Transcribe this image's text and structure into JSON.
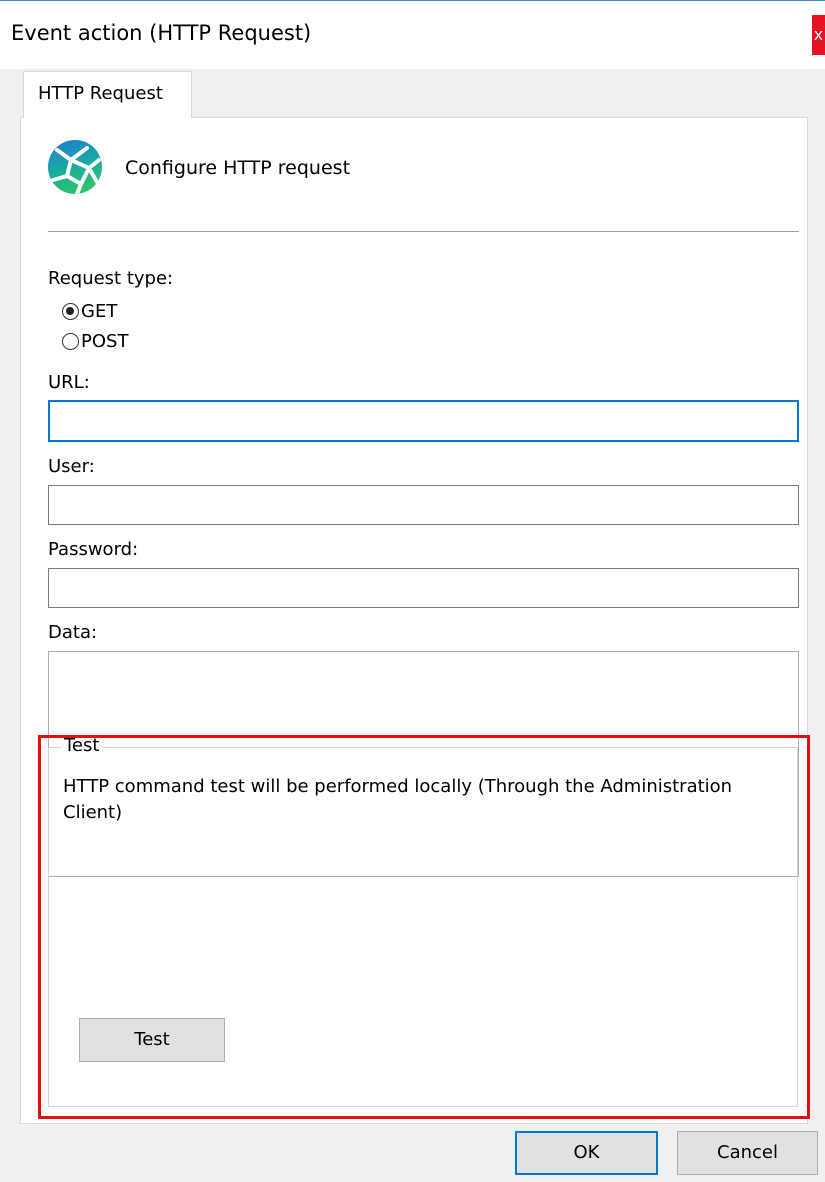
{
  "window": {
    "title": "Event action (HTTP Request)",
    "close_glyph": "x"
  },
  "tab": {
    "label": "HTTP Request"
  },
  "header": {
    "icon": "network-globe-icon",
    "label": "Configure HTTP request"
  },
  "request_type": {
    "label": "Request type:",
    "options": [
      {
        "label": "GET",
        "checked": true
      },
      {
        "label": "POST",
        "checked": false
      }
    ]
  },
  "fields": {
    "url_label": "URL:",
    "url_value": "",
    "user_label": "User:",
    "user_value": "",
    "password_label": "Password:",
    "password_value": "",
    "data_label": "Data:",
    "data_value": ""
  },
  "test_group": {
    "title": "Test",
    "description": "HTTP command test will be performed locally (Through the Administration Client)",
    "button_label": "Test"
  },
  "footer": {
    "ok_label": "OK",
    "cancel_label": "Cancel"
  },
  "colors": {
    "focus_border": "#0078d7",
    "highlight_border": "#e01010",
    "close_button": "#e81123"
  }
}
